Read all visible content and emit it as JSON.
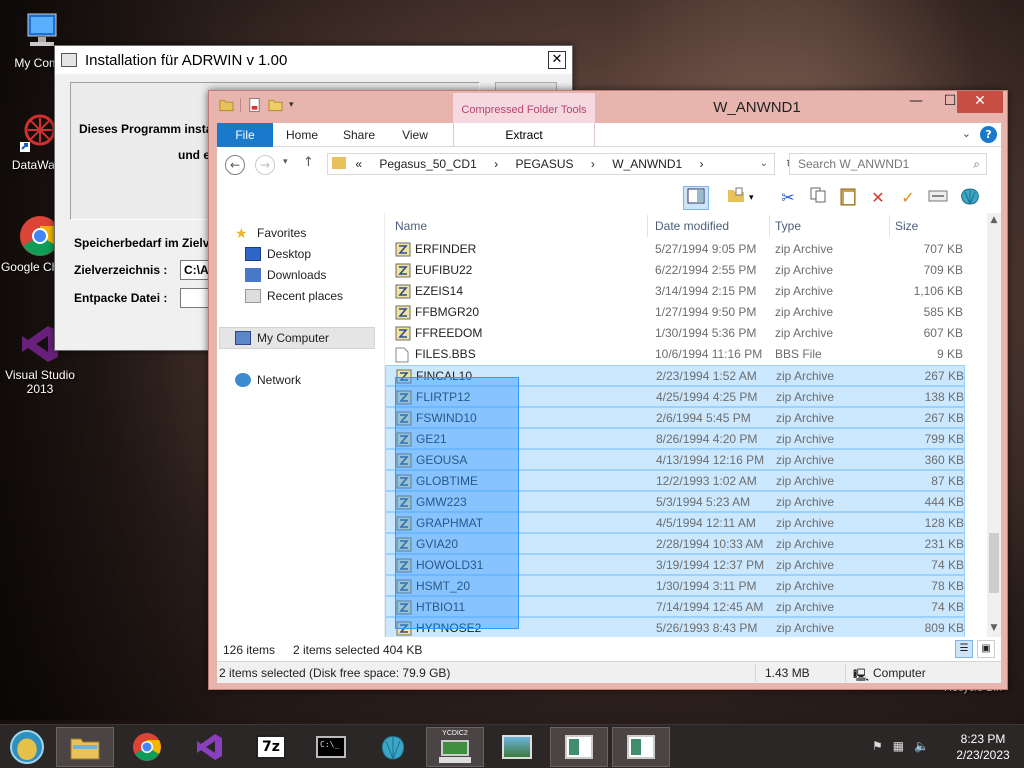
{
  "desktop": {
    "icons": [
      {
        "label": "My Comp"
      },
      {
        "label": "DataWage"
      },
      {
        "label": "Google Chrom"
      },
      {
        "label": "Visual Studio 2013"
      }
    ],
    "recycle_label": "Recycle Bin"
  },
  "installer": {
    "title": "Installation für ADRWIN v 1.00",
    "close": "✕",
    "text1": "Dieses Programm instal",
    "text2": "und e",
    "label_space": "Speicherbedarf im Zielv",
    "label_target": "Zielverzeichnis :",
    "target_value": "C:\\A",
    "label_extract": "Entpacke Datei :"
  },
  "explorer": {
    "title": "W_ANWND1",
    "context_tab": "Compressed Folder Tools",
    "context_subtab": "Extract",
    "tabs": [
      "File",
      "Home",
      "Share",
      "View"
    ],
    "breadcrumb": [
      "«",
      "Pegasus_50_CD1",
      "›",
      "PEGASUS",
      "›",
      "W_ANWND1",
      "›"
    ],
    "search_placeholder": "Search W_ANWND1",
    "nav": {
      "favorites": "Favorites",
      "desktop": "Desktop",
      "downloads": "Downloads",
      "recent": "Recent places",
      "my_computer": "My Computer",
      "network": "Network"
    },
    "columns": {
      "name": "Name",
      "date": "Date modified",
      "type": "Type",
      "size": "Size"
    },
    "files": [
      {
        "name": "ERFINDER",
        "date": "5/27/1994 9:05 PM",
        "type": "zip Archive",
        "size": "707 KB",
        "selected": false
      },
      {
        "name": "EUFIBU22",
        "date": "6/22/1994 2:55 PM",
        "type": "zip Archive",
        "size": "709 KB",
        "selected": false
      },
      {
        "name": "EZEIS14",
        "date": "3/14/1994 2:15 PM",
        "type": "zip Archive",
        "size": "1,106 KB",
        "selected": false
      },
      {
        "name": "FFBMGR20",
        "date": "1/27/1994 9:50 PM",
        "type": "zip Archive",
        "size": "585 KB",
        "selected": false
      },
      {
        "name": "FFREEDOM",
        "date": "1/30/1994 5:36 PM",
        "type": "zip Archive",
        "size": "607 KB",
        "selected": false
      },
      {
        "name": "FILES.BBS",
        "date": "10/6/1994 11:16 PM",
        "type": "BBS File",
        "size": "9 KB",
        "selected": false
      },
      {
        "name": "FINCAL10",
        "date": "2/23/1994 1:52 AM",
        "type": "zip Archive",
        "size": "267 KB",
        "selected": true
      },
      {
        "name": "FLIRTP12",
        "date": "4/25/1994 4:25 PM",
        "type": "zip Archive",
        "size": "138 KB",
        "selected": true
      },
      {
        "name": "FSWIND10",
        "date": "2/6/1994 5:45 PM",
        "type": "zip Archive",
        "size": "267 KB",
        "selected": true
      },
      {
        "name": "GE21",
        "date": "8/26/1994 4:20 PM",
        "type": "zip Archive",
        "size": "799 KB",
        "selected": true
      },
      {
        "name": "GEOUSA",
        "date": "4/13/1994 12:16 PM",
        "type": "zip Archive",
        "size": "360 KB",
        "selected": true
      },
      {
        "name": "GLOBTIME",
        "date": "12/2/1993 1:02 AM",
        "type": "zip Archive",
        "size": "87 KB",
        "selected": true
      },
      {
        "name": "GMW223",
        "date": "5/3/1994 5:23 AM",
        "type": "zip Archive",
        "size": "444 KB",
        "selected": true
      },
      {
        "name": "GRAPHMAT",
        "date": "4/5/1994 12:11 AM",
        "type": "zip Archive",
        "size": "128 KB",
        "selected": true
      },
      {
        "name": "GVIA20",
        "date": "2/28/1994 10:33 AM",
        "type": "zip Archive",
        "size": "231 KB",
        "selected": true
      },
      {
        "name": "HOWOLD31",
        "date": "3/19/1994 12:37 PM",
        "type": "zip Archive",
        "size": "74 KB",
        "selected": true
      },
      {
        "name": "HSMT_20",
        "date": "1/30/1994 3:11 PM",
        "type": "zip Archive",
        "size": "78 KB",
        "selected": true
      },
      {
        "name": "HTBIO11",
        "date": "7/14/1994 12:45 AM",
        "type": "zip Archive",
        "size": "74 KB",
        "selected": true
      },
      {
        "name": "HYPNOSE2",
        "date": "5/26/1993 8:43 PM",
        "type": "zip Archive",
        "size": "809 KB",
        "selected": true
      }
    ],
    "status": {
      "items": "126 items",
      "selected": "2 items selected",
      "size": "404 KB",
      "bottom_left": "2 items selected (Disk free space: 79.9 GB)",
      "bottom_size": "1.43 MB",
      "bottom_location": "Computer"
    }
  },
  "taskbar": {
    "time": "8:23 PM",
    "date": "2/23/2023",
    "ycdic_label": "YCDIC2"
  },
  "colors": {
    "accent": "#1979ca",
    "window_frame": "#e8b4ae",
    "selection": "#cce8ff",
    "context_tab": "#b6456d"
  }
}
